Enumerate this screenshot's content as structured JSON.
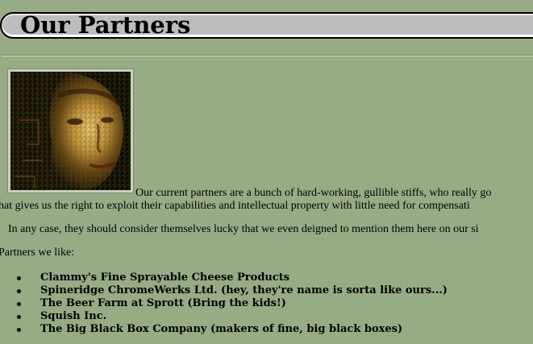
{
  "header": {
    "title": "Our Partners"
  },
  "intro": {
    "line1": "Our current partners are a bunch of hard-working, gullible stiffs, who really go",
    "line2": "hat gives us the right to exploit their capabilities and intellectual property with little need for compensati",
    "line3": "In any case, they should consider themselves lucky that we even deigned to mention them here on our si"
  },
  "partners_label": "Partners we like:",
  "partners": [
    "Clammy's Fine Sprayable Cheese Products",
    "Spineridge ChromeWerks Ltd. (hey, they're name is sorta like ours...)",
    "The Beer Farm at Sprott (Bring the kids!)",
    "Squish Inc.",
    "The Big Black Box Company (makers of fine, big black boxes)"
  ],
  "colors": {
    "page_background": "#97ab85",
    "header_bar": "#bdbdbd"
  },
  "image": {
    "subject": "face-circuit-board-photo"
  }
}
